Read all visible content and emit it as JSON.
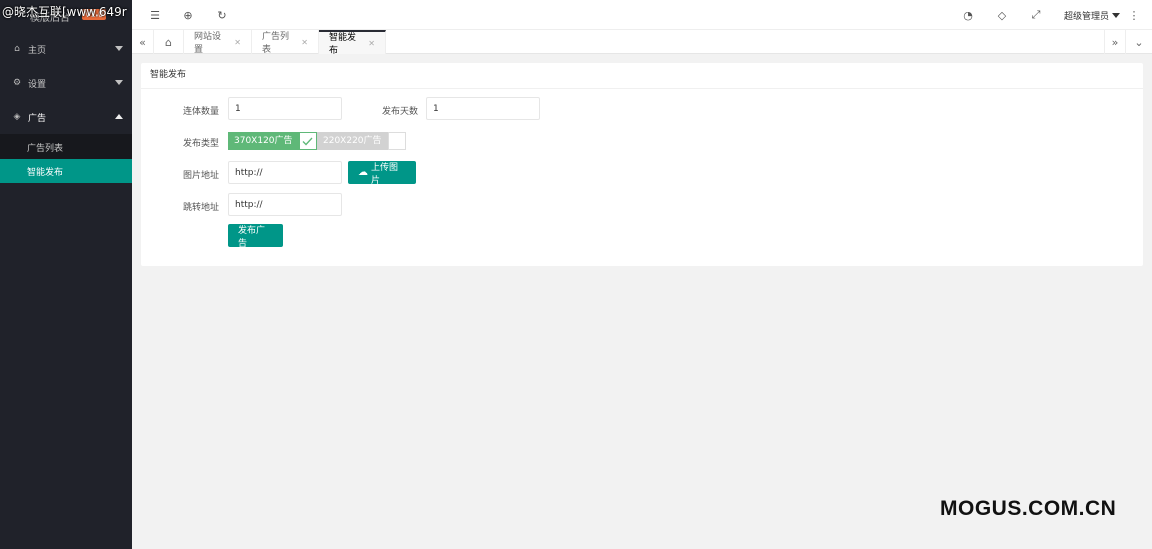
{
  "overlay": {
    "top_left_watermark": "@晓杰互联[www.649r",
    "bottom_right_watermark": "MOGUS.COM.CN"
  },
  "sidebar": {
    "logo_text": "模版后台",
    "logo_badge": "V1.0",
    "items": [
      {
        "label": "主页",
        "icon": "home-icon"
      },
      {
        "label": "设置",
        "icon": "gear-icon"
      },
      {
        "label": "广告",
        "icon": "diamond-icon"
      }
    ],
    "submenu": [
      {
        "label": "广告列表"
      },
      {
        "label": "智能发布",
        "active": true
      }
    ]
  },
  "header": {
    "user": "超级管理员",
    "icons": [
      "menu-toggle-icon",
      "globe-icon",
      "refresh-icon",
      "theme-icon",
      "tag-icon",
      "fullscreen-icon",
      "more-icon"
    ]
  },
  "tabs": {
    "items": [
      {
        "label": "网站设置"
      },
      {
        "label": "广告列表"
      },
      {
        "label": "智能发布",
        "active": true
      }
    ]
  },
  "form": {
    "title": "智能发布",
    "count_label": "连体数量",
    "count_value": "1",
    "days_label": "发布天数",
    "days_value": "1",
    "type_label": "发布类型",
    "type_option_1": "370X120广告",
    "type_option_2": "220X220广告",
    "image_label": "图片地址",
    "image_value": "http://",
    "upload_button": "上传图片",
    "link_label": "跳转地址",
    "link_value": "http://",
    "submit_button": "发布广告"
  },
  "colors": {
    "primary": "#009688",
    "checked": "#5fb878",
    "unchecked": "#d2d2d2",
    "sidebar_bg": "#20222a"
  }
}
